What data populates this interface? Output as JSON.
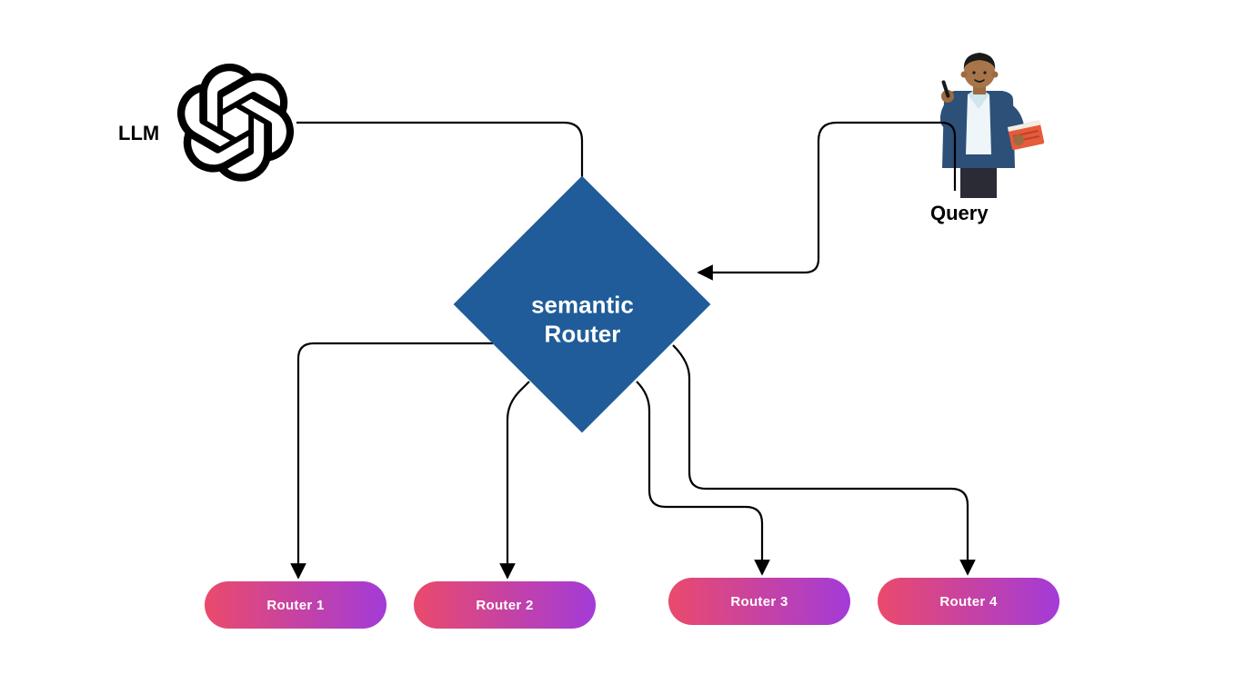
{
  "nodes": {
    "llm": {
      "label": "LLM",
      "icon": "openai-knot-icon"
    },
    "query": {
      "label": "Query",
      "icon": "person-with-book-icon"
    },
    "center": {
      "line1": "semantic",
      "line2": "Router"
    }
  },
  "routers": [
    {
      "label": "Router  1"
    },
    {
      "label": "Router 2"
    },
    {
      "label": "Router 3"
    },
    {
      "label": "Router 4"
    }
  ],
  "colors": {
    "diamond_fill": "#1f5c99",
    "pill_gradient_from": "#ea4a6c",
    "pill_gradient_to": "#a33bd8",
    "connector": "#000000"
  },
  "connections": [
    {
      "from": "llm",
      "to": "center",
      "direction": "into-center"
    },
    {
      "from": "query",
      "to": "center",
      "direction": "into-center"
    },
    {
      "from": "center",
      "to": "router1",
      "direction": "out"
    },
    {
      "from": "center",
      "to": "router2",
      "direction": "out"
    },
    {
      "from": "center",
      "to": "router3",
      "direction": "out"
    },
    {
      "from": "center",
      "to": "router4",
      "direction": "out"
    }
  ]
}
